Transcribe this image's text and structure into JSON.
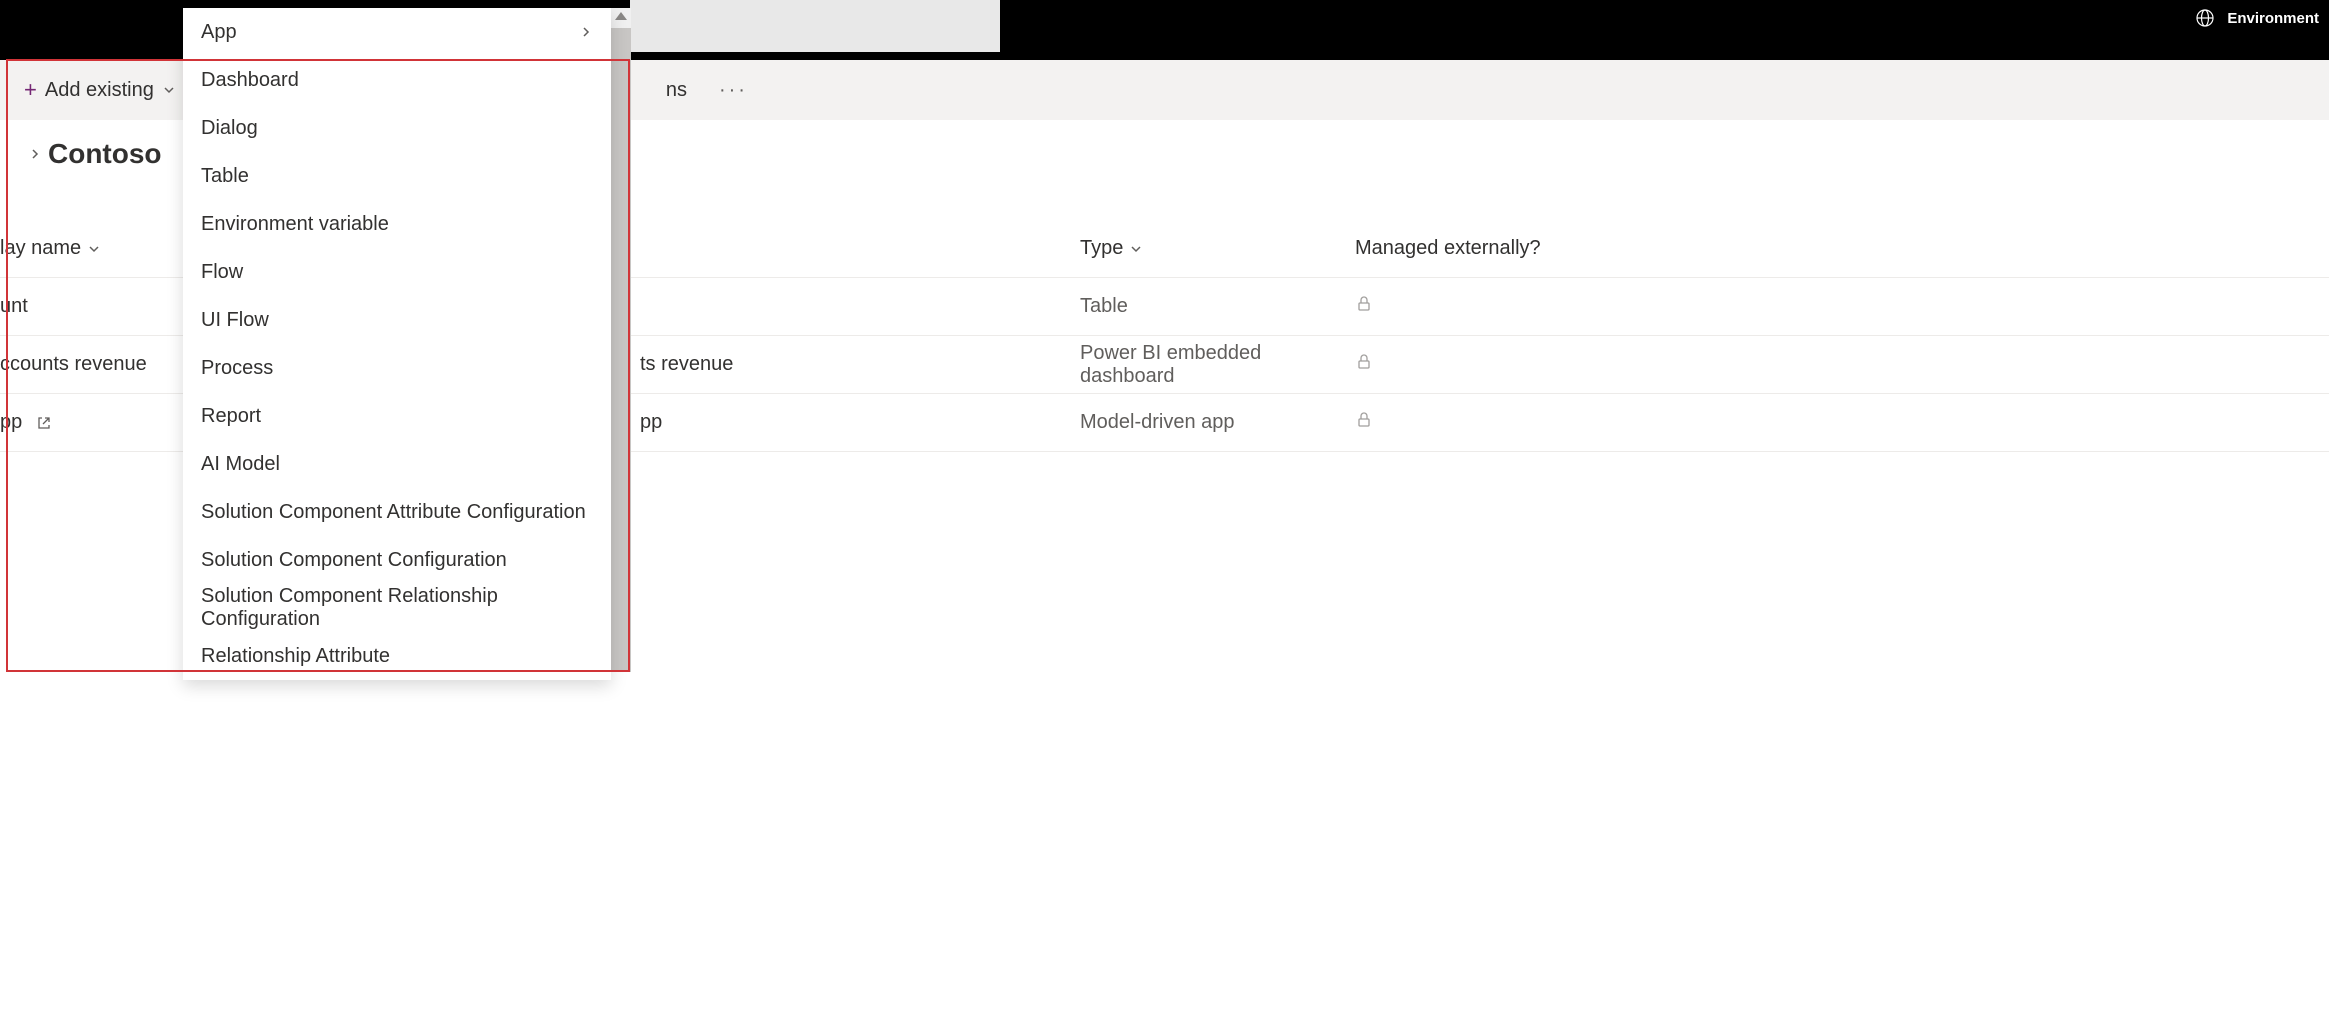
{
  "topBar": {
    "envLabel": "Environment"
  },
  "commandBar": {
    "addExisting": "Add existing",
    "trailingItem": "ns"
  },
  "page": {
    "title": "Contoso"
  },
  "dropdown": {
    "items": [
      {
        "label": "App",
        "hasFlyout": true
      },
      {
        "label": "Dashboard",
        "hasFlyout": false
      },
      {
        "label": "Dialog",
        "hasFlyout": false
      },
      {
        "label": "Table",
        "hasFlyout": false
      },
      {
        "label": "Environment variable",
        "hasFlyout": false
      },
      {
        "label": "Flow",
        "hasFlyout": false
      },
      {
        "label": "UI Flow",
        "hasFlyout": false
      },
      {
        "label": "Process",
        "hasFlyout": false
      },
      {
        "label": "Report",
        "hasFlyout": false
      },
      {
        "label": "AI Model",
        "hasFlyout": false
      },
      {
        "label": "Solution Component Attribute Configuration",
        "hasFlyout": false
      },
      {
        "label": "Solution Component Configuration",
        "hasFlyout": false
      },
      {
        "label": "Solution Component Relationship Configuration",
        "hasFlyout": false
      },
      {
        "label": "Relationship Attribute",
        "hasFlyout": false
      }
    ]
  },
  "table": {
    "headers": {
      "displayName": "lay name",
      "type": "Type",
      "managed": "Managed externally?"
    },
    "rows": [
      {
        "displayName": "unt",
        "middle": "",
        "type": "Table",
        "hasOpen": false
      },
      {
        "displayName": "ccounts revenue",
        "middle": "ts revenue",
        "type": "Power BI embedded dashboard",
        "hasOpen": false
      },
      {
        "displayName": "pp",
        "middle": "pp",
        "type": "Model-driven app",
        "hasOpen": true
      }
    ]
  }
}
